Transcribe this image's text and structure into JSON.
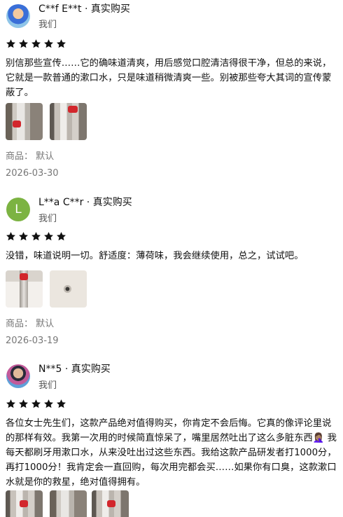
{
  "colors": {
    "star": "#111111",
    "meta_text": "#777777"
  },
  "reviews": [
    {
      "name": "C**f E**t · 真实购买",
      "sub": "我们",
      "rating": 5,
      "text": "别信那些宣传……它的确味道清爽，用后感觉口腔清洁得很干净，但总的来说，它就是一款普通的漱口水，只是味道稍微清爽一些。别被那些夸大其词的宣传蒙蔽了。",
      "product_label": "商品：  默认",
      "date": "2026-03-30"
    },
    {
      "name": "L**a C**r · 真实购买",
      "avatar_letter": "L",
      "sub": "我们",
      "rating": 5,
      "text": "没错，味道说明一切。舒适度：薄荷味，我会继续使用，总之，试试吧。",
      "product_label": "商品：  默认",
      "date": "2026-03-19"
    },
    {
      "name": "N**5 · 真实购买",
      "sub": "我们",
      "rating": 5,
      "text": "各位女士先生们，这款产品绝对值得购买，你肯定不会后悔。它真的像评论里说的那样有效。我第一次用的时候简直惊呆了，嘴里居然吐出了这么多脏东西🤦🏽‍♀️ 我每天都刷牙用漱口水，从来没吐出过这些东西。我给这款产品研发者打1000分，再打1000分！我肯定会一直回购，每次用完都会买……如果你有口臭，这款漱口水就是你的救星，绝对值得拥有。"
    }
  ]
}
